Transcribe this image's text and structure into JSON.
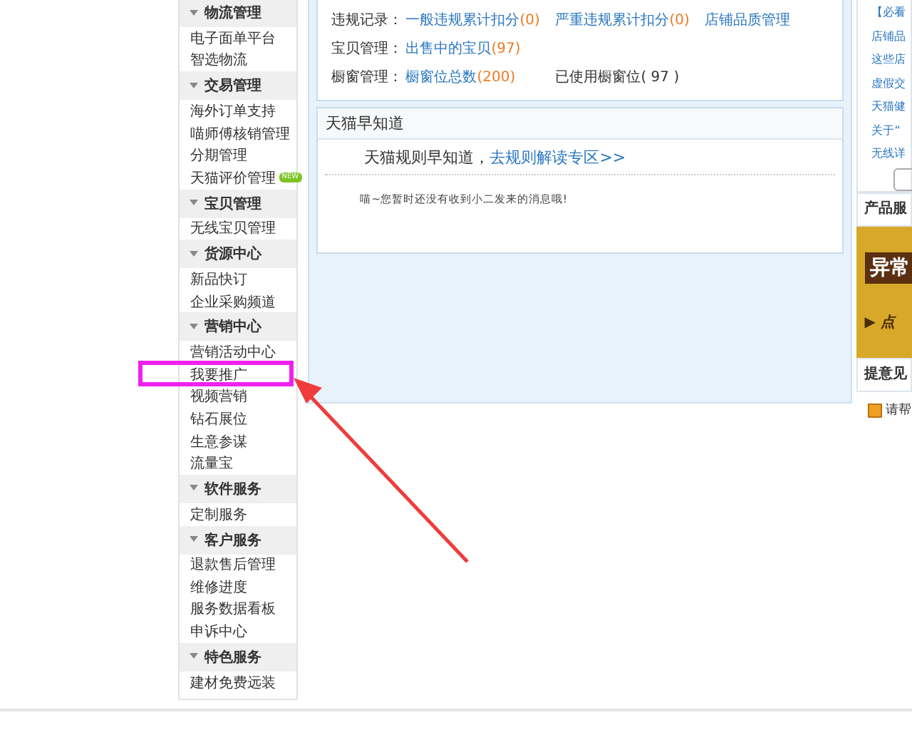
{
  "sidebar": {
    "groups": [
      {
        "title": "物流管理",
        "expanded": true,
        "items": [
          {
            "label": "电子面单平台"
          },
          {
            "label": "智选物流"
          }
        ]
      },
      {
        "title": "交易管理",
        "expanded": true,
        "items": [
          {
            "label": "海外订单支持"
          },
          {
            "label": "喵师傅核销管理"
          },
          {
            "label": "分期管理"
          },
          {
            "label": "天猫评价管理",
            "badge": "NEW"
          }
        ]
      },
      {
        "title": "宝贝管理",
        "expanded": true,
        "items": [
          {
            "label": "无线宝贝管理"
          }
        ]
      },
      {
        "title": "货源中心",
        "expanded": true,
        "items": [
          {
            "label": "新品快订"
          },
          {
            "label": "企业采购频道"
          }
        ]
      },
      {
        "title": "营销中心",
        "expanded": true,
        "items": [
          {
            "label": "营销活动中心"
          },
          {
            "label": "我要推广"
          },
          {
            "label": "视频营销"
          },
          {
            "label": "钻石展位"
          },
          {
            "label": "生意参谋"
          },
          {
            "label": "流量宝"
          }
        ]
      },
      {
        "title": "软件服务",
        "expanded": true,
        "items": [
          {
            "label": "定制服务"
          }
        ]
      },
      {
        "title": "客户服务",
        "expanded": true,
        "items": [
          {
            "label": "退款售后管理"
          },
          {
            "label": "维修进度"
          },
          {
            "label": "服务数据看板"
          },
          {
            "label": "申诉中心"
          }
        ]
      },
      {
        "title": "特色服务",
        "expanded": true,
        "items": [
          {
            "label": "建材免费远装"
          }
        ]
      }
    ]
  },
  "shop_info": {
    "rows": [
      {
        "label": "违规记录：",
        "cells": [
          {
            "link": "一般违规累计扣分",
            "count": "(0)"
          },
          {
            "link": "严重违规累计扣分",
            "count": "(0)"
          },
          {
            "link": "店铺品质管理"
          }
        ]
      },
      {
        "label": "宝贝管理：",
        "cells": [
          {
            "link": "出售中的宝贝",
            "count": "(97)"
          }
        ]
      },
      {
        "label": "橱窗管理：",
        "cells": [
          {
            "link": "橱窗位总数",
            "count": "(200)"
          },
          {
            "text": "已使用橱窗位( 97 )"
          }
        ]
      }
    ]
  },
  "notice": {
    "title": "天猫早知道",
    "lead": "天猫规则早知道，",
    "link": "去规则解读专区>>",
    "message": "喵~您暂时还没有收到小二发来的消息哦!"
  },
  "right_panel": {
    "links": [
      "【必看",
      "店铺品",
      "这些店",
      "虚假交",
      "天猫健",
      "关于“",
      "无线详"
    ],
    "services_title": "产品服",
    "banner_text": "异常",
    "banner_link": "▶ 点",
    "feedback_title": "提意见",
    "feedback_link": "请帮"
  },
  "annotation": {
    "highlight": true
  }
}
